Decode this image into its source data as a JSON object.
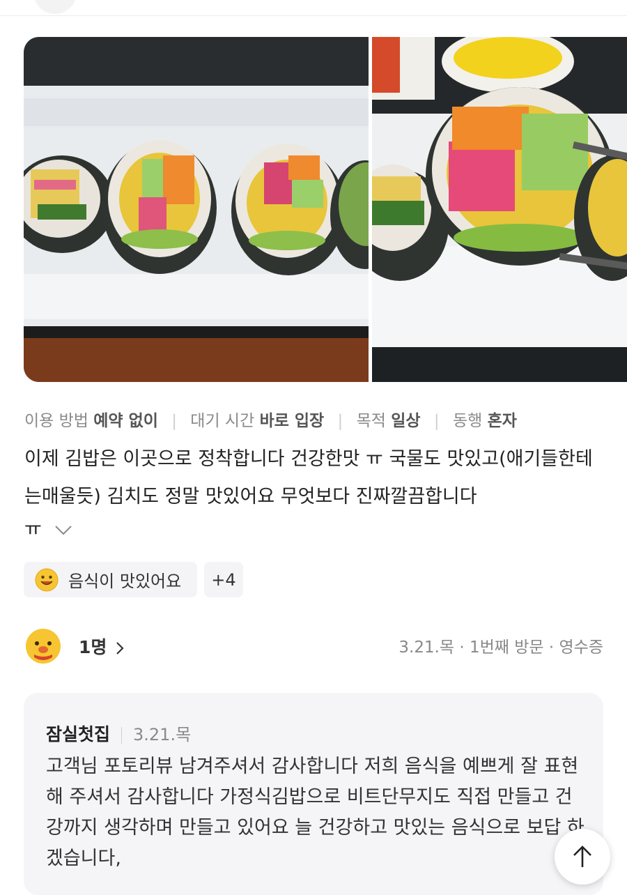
{
  "meta": {
    "usage_label": "이용 방법",
    "usage_value": "예약 없이",
    "wait_label": "대기 시간",
    "wait_value": "바로 입장",
    "purpose_label": "목적",
    "purpose_value": "일상",
    "company_label": "동행",
    "company_value": "혼자"
  },
  "review": {
    "text": "이제 김밥은 이곳으로 정착합니다 건강한맛 ㅠ 국물도 맛있고(애기들한테는매울듯) 김치도 정말 맛있어요 무엇보다 진짜깔끔합니다",
    "tail": "ㅠ"
  },
  "tags": {
    "main": "음식이 맛있어요",
    "more": "+4"
  },
  "visit": {
    "count": "1명",
    "info": "3.21.목 · 1번째 방문 · 영수증"
  },
  "reply": {
    "name": "잠실첫집",
    "date": "3.21.목",
    "text": "고객님 포토리뷰 남겨주셔서 감사합니다 저희 음식을 예쁘게 잘 표현해 주셔서 감사합니다 가정식김밥으로 비트단무지도 직접 만들고 건강까지 생각하며 만들고 있어요 늘 건강하고 맛있는 음식으로 보답 하겠습니다,"
  },
  "icons": {
    "expand": "chevron-down-icon",
    "emoji": "smiley-icon",
    "avatar": "chick-avatar-icon",
    "scroll_top": "arrow-up-icon"
  }
}
